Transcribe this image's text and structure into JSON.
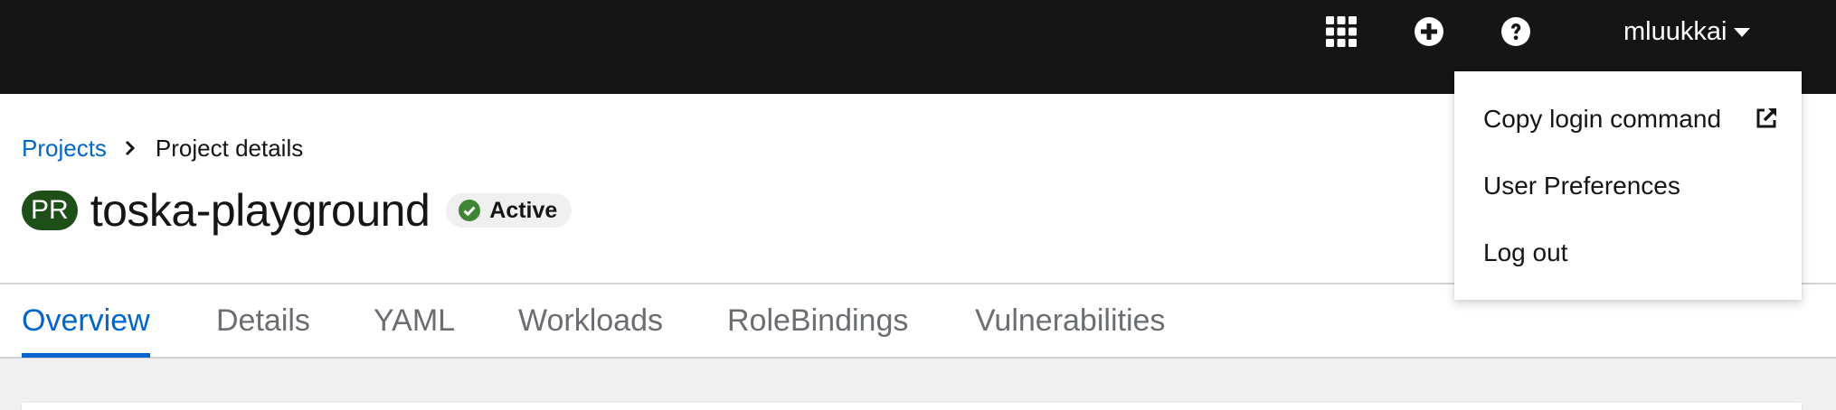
{
  "masthead": {
    "icons": {
      "app_launcher": "grid-icon",
      "quick_create": "plus-circle-icon",
      "help": "question-circle-icon"
    },
    "user_menu": {
      "username": "mluukkai",
      "caret_icon": "caret-down-icon"
    }
  },
  "breadcrumb": {
    "items": [
      "Projects",
      "Project details"
    ],
    "separator_icon": "chevron-right-icon"
  },
  "project": {
    "badge": "PR",
    "name": "toska-playground",
    "status": "Active",
    "status_icon": "check-circle-icon",
    "status_color": "#3e8635",
    "badge_color": "#1e4f18"
  },
  "tabs": [
    {
      "label": "Overview",
      "active": true
    },
    {
      "label": "Details",
      "active": false
    },
    {
      "label": "YAML",
      "active": false
    },
    {
      "label": "Workloads",
      "active": false
    },
    {
      "label": "RoleBindings",
      "active": false
    },
    {
      "label": "Vulnerabilities",
      "active": false
    }
  ],
  "user_dropdown": {
    "items": [
      {
        "label": "Copy login command",
        "icon": "external-link-icon"
      },
      {
        "label": "User Preferences"
      },
      {
        "label": "Log out"
      }
    ]
  },
  "colors": {
    "masthead_bg": "#151515",
    "link": "#0066cc",
    "tab_inactive": "#6a6e73"
  }
}
